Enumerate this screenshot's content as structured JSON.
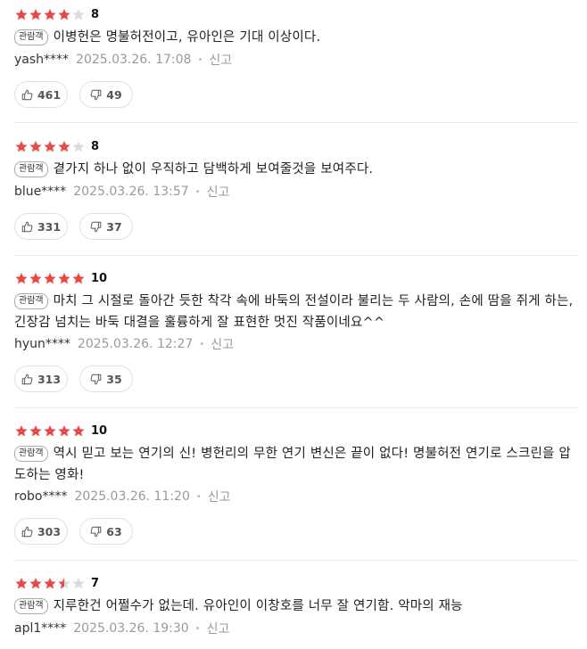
{
  "colors": {
    "star_on": "#e34c4c",
    "star_off": "#dcdcdc",
    "divider": "#ebebeb"
  },
  "reviews": [
    {
      "stars": 4,
      "score": "8",
      "badge": "관람객",
      "text": "이병헌은 명불허전이고, 유아인은 기대 이상이다.",
      "user": "yash****",
      "date": "2025.03.26. 17:08",
      "report": "신고",
      "likes": "461",
      "dislikes": "49"
    },
    {
      "stars": 4,
      "score": "8",
      "badge": "관람객",
      "text": "곁가지 하나 없이 우직하고 담백하게 보여줄것을 보여주다.",
      "user": "blue****",
      "date": "2025.03.26. 13:57",
      "report": "신고",
      "likes": "331",
      "dislikes": "37"
    },
    {
      "stars": 5,
      "score": "10",
      "badge": "관람객",
      "text": "마치 그 시절로 돌아간 듯한 착각 속에 바둑의 전설이라 불리는 두 사람의, 손에 땀을 쥐게 하는, 긴장감 넘치는 바둑 대결을 훌륭하게 잘 표현한 멋진 작품이네요^^",
      "user": "hyun****",
      "date": "2025.03.26. 12:27",
      "report": "신고",
      "likes": "313",
      "dislikes": "35"
    },
    {
      "stars": 5,
      "score": "10",
      "badge": "관람객",
      "text": "역시 믿고 보는 연기의 신! 병헌리의 무한 연기 변신은 끝이 없다! 명불허전 연기로 스크린을 압도하는 영화!",
      "user": "robo****",
      "date": "2025.03.26. 11:20",
      "report": "신고",
      "likes": "303",
      "dislikes": "63"
    },
    {
      "stars": 3.5,
      "score": "7",
      "badge": "관람객",
      "text": "지루한건 어쩔수가 없는데. 유아인이 이창호를 너무 잘 연기함. 악마의 재능",
      "user": "apl1****",
      "date": "2025.03.26. 19:30",
      "report": "신고",
      "likes": "",
      "dislikes": ""
    }
  ]
}
